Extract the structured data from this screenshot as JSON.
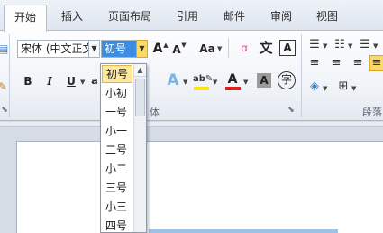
{
  "tabs": [
    {
      "label": "开始",
      "active": true
    },
    {
      "label": "插入"
    },
    {
      "label": "页面布局"
    },
    {
      "label": "引用"
    },
    {
      "label": "邮件"
    },
    {
      "label": "审阅"
    },
    {
      "label": "视图"
    }
  ],
  "font": {
    "name_value": "宋体 (中文正文)",
    "size_value": "初号"
  },
  "buttons": {
    "grow": "A",
    "shrink": "A",
    "change_case": "Aa",
    "bold": "B",
    "italic": "I",
    "underline": "U",
    "strike": "a",
    "phonetic": "文",
    "enclose": "A",
    "circle": "字"
  },
  "group_labels": {
    "font": "体",
    "paragraph": "段落"
  },
  "size_options": [
    "初号",
    "小初",
    "一号",
    "小一",
    "二号",
    "小二",
    "三号",
    "小三",
    "四号"
  ],
  "colors": {
    "tab_active_bg": "#fdfdfe",
    "combo_selected": "#3d8ee0",
    "dropdown_selected": "#fde8a0",
    "highlight_yellow": "#f7e700",
    "font_red": "#e02020",
    "accent_blue": "#2f7bd8"
  }
}
